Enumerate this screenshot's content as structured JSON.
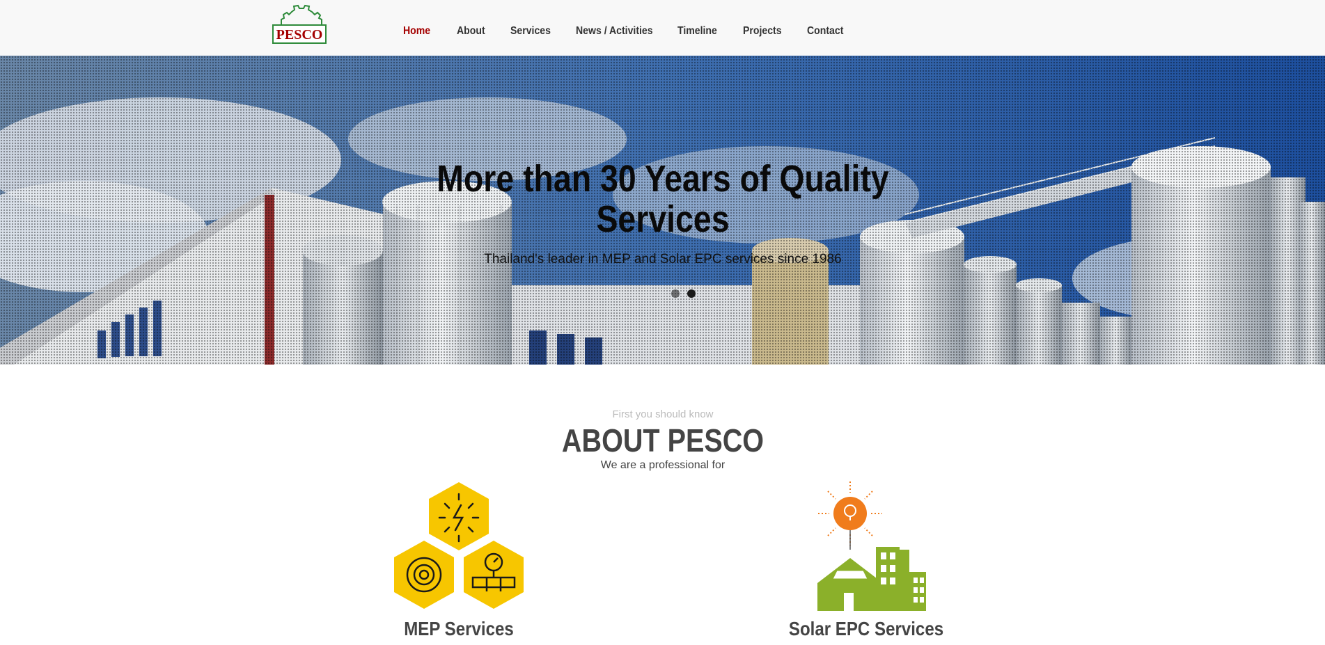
{
  "header": {
    "logo_text": "PESCO",
    "nav": [
      {
        "label": "Home",
        "active": true
      },
      {
        "label": "About",
        "active": false
      },
      {
        "label": "Services",
        "active": false
      },
      {
        "label": "News / Activities",
        "active": false
      },
      {
        "label": "Timeline",
        "active": false
      },
      {
        "label": "Projects",
        "active": false
      },
      {
        "label": "Contact",
        "active": false
      }
    ]
  },
  "hero": {
    "title_line1": "More than 30 Years of Quality",
    "title_line2": "Services",
    "subtitle": "Thailand's leader in MEP and Solar EPC services since 1986",
    "slides_count": 2,
    "active_slide": 2
  },
  "about": {
    "kicker": "First you should know",
    "title": "ABOUT PESCO",
    "description": "We are a professional for"
  },
  "services": [
    {
      "title": "MEP Services",
      "icon": "mep-hexagons-icon"
    },
    {
      "title": "Solar EPC Services",
      "icon": "solar-house-icon"
    }
  ],
  "colors": {
    "accent": "#a40000",
    "logo_green": "#2e8b3a",
    "mep_yellow": "#f7c600",
    "solar_orange": "#f07c1c",
    "solar_green": "#8bb02a"
  }
}
